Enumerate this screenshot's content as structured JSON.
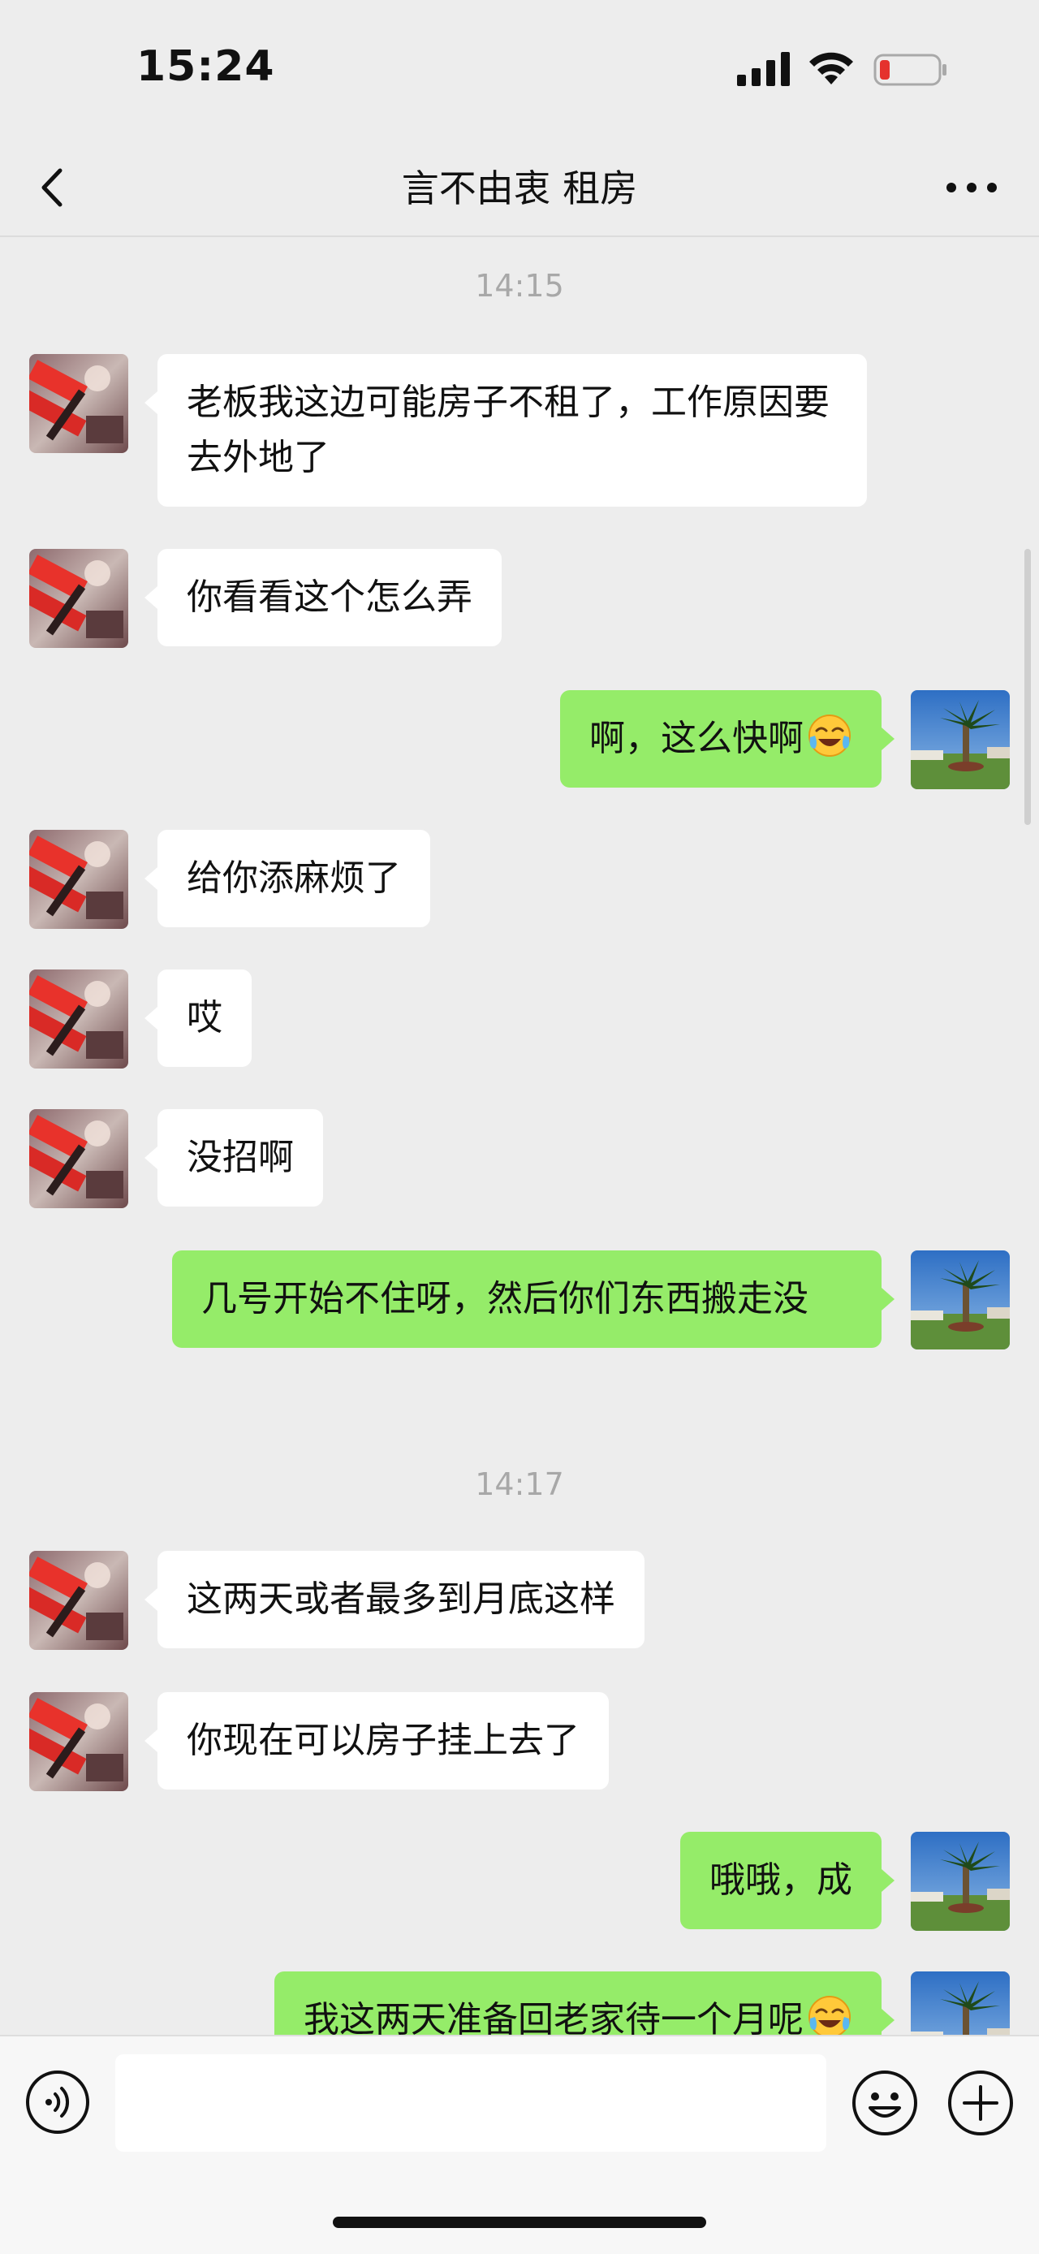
{
  "status_bar": {
    "time": "15:24"
  },
  "header": {
    "title": "言不由衷 租房"
  },
  "timestamps": [
    "14:15",
    "14:17"
  ],
  "messages": [
    {
      "side": "in",
      "text": "老板我这边可能房子不租了，工作原因要去外地了"
    },
    {
      "side": "in",
      "text": "你看看这个怎么弄"
    },
    {
      "side": "out",
      "text": "啊，这么快啊",
      "emoji": "face-with-tears-of-joy"
    },
    {
      "side": "in",
      "text": "给你添麻烦了"
    },
    {
      "side": "in",
      "text": "哎"
    },
    {
      "side": "in",
      "text": "没招啊"
    },
    {
      "side": "out",
      "text": "几号开始不住呀，然后你们东西搬走没"
    },
    {
      "side": "in",
      "text": "这两天或者最多到月底这样"
    },
    {
      "side": "in",
      "text": "你现在可以房子挂上去了"
    },
    {
      "side": "out",
      "text": "哦哦，成"
    },
    {
      "side": "out",
      "text": "我这两天准备回老家待一个月呢",
      "emoji": "face-with-tears-of-joy"
    }
  ],
  "input_bar": {
    "input_value": ""
  },
  "colors": {
    "background": "#EDEDED",
    "outgoing_bubble": "#95EC69",
    "incoming_bubble": "#FFFFFF",
    "battery_low": "#E5322D"
  },
  "icons": {
    "back": "chevron-left-icon",
    "more": "more-dots-icon",
    "voice": "voice-icon",
    "emoji": "emoji-face-icon",
    "plus": "plus-icon"
  }
}
